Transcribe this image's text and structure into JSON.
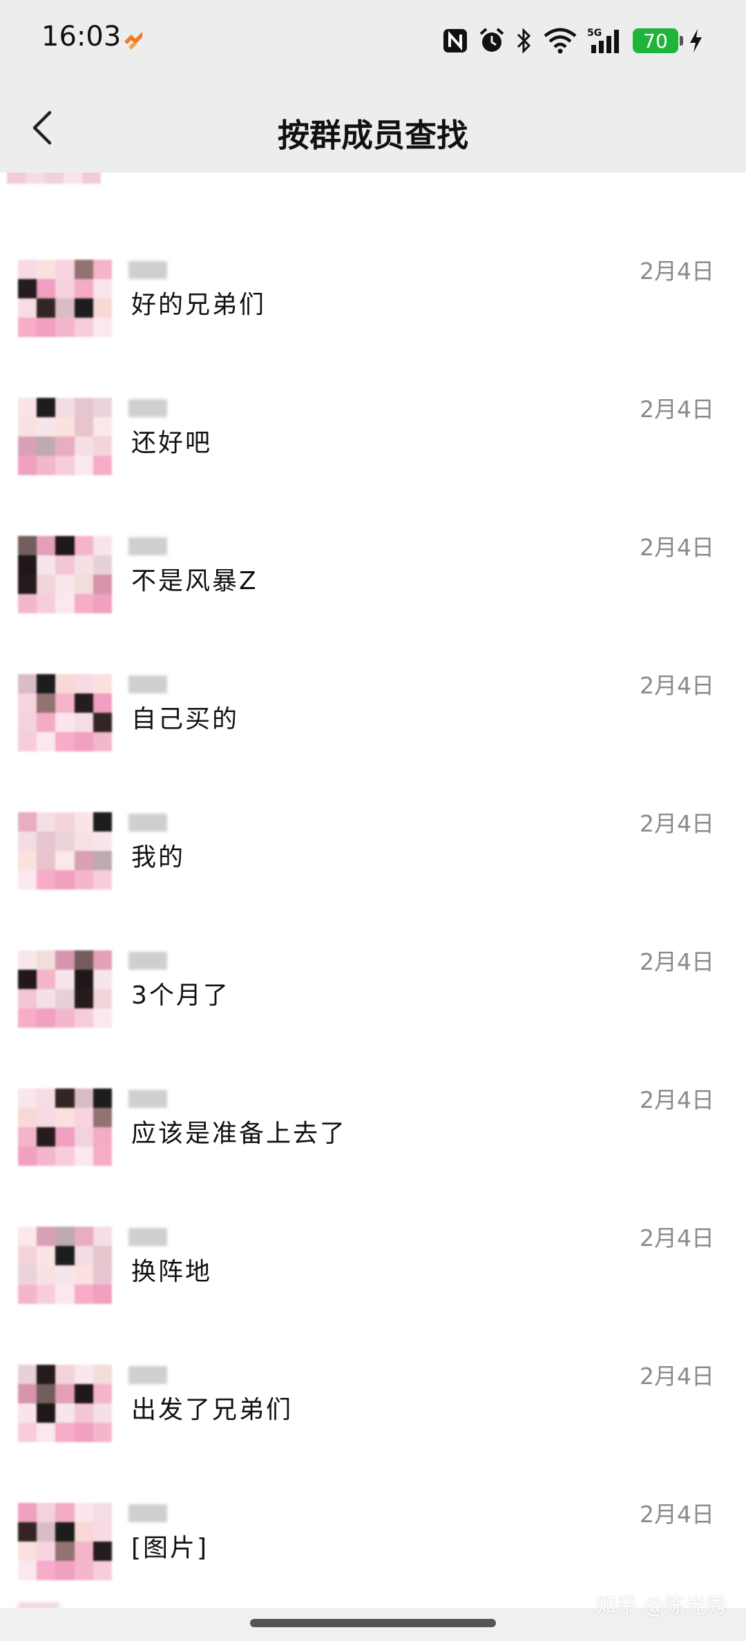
{
  "status_bar": {
    "time": "16:03",
    "battery": "70",
    "icons": [
      "nfc-icon",
      "alarm-icon",
      "bluetooth-icon",
      "wifi-icon",
      "5g-signal-icon",
      "battery-icon",
      "charging-icon"
    ]
  },
  "header": {
    "title": "按群成员查找",
    "back_icon": "chevron-left-icon"
  },
  "messages": [
    {
      "text": "好的兄弟们",
      "date": "2月4日"
    },
    {
      "text": "还好吧",
      "date": "2月4日"
    },
    {
      "text": "不是风暴Z",
      "date": "2月4日"
    },
    {
      "text": "自己买的",
      "date": "2月4日"
    },
    {
      "text": "我的",
      "date": "2月4日"
    },
    {
      "text": "3个月了",
      "date": "2月4日"
    },
    {
      "text": "应该是准备上去了",
      "date": "2月4日"
    },
    {
      "text": "换阵地",
      "date": "2月4日"
    },
    {
      "text": "出发了兄弟们",
      "date": "2月4日"
    },
    {
      "text": "[图片]",
      "date": "2月4日"
    }
  ],
  "watermark": "知乎 @陈光秀",
  "colors": {
    "header_bg": "#ededed",
    "battery_green": "#1fb53a",
    "date_gray": "#8a8a8a"
  }
}
